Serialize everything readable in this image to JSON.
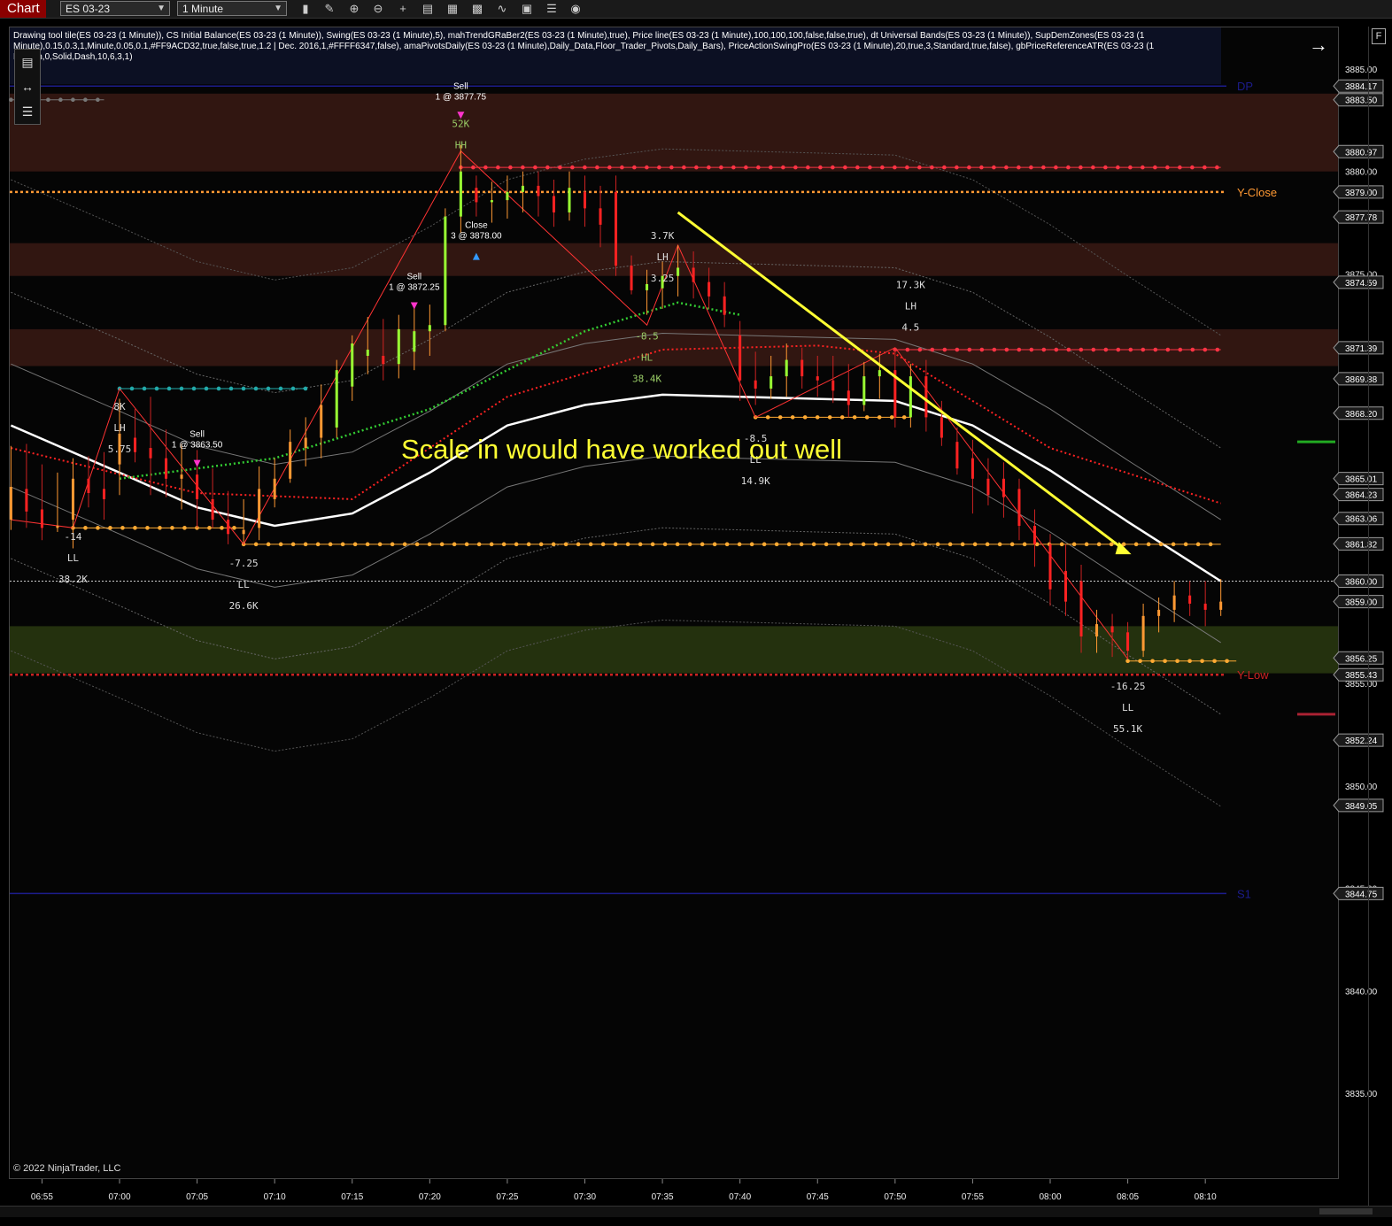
{
  "toolbar": {
    "tab_label": "Chart",
    "instrument": "ES 03-23",
    "interval": "1 Minute",
    "icons": [
      "bar-type-icon",
      "drawing-pencil-icon",
      "zoom-in-icon",
      "zoom-out-icon",
      "crosshair-icon",
      "properties-icon",
      "strategies-icon",
      "indicators-icon",
      "data-series-icon",
      "chart-trader-icon",
      "list-icon",
      "pin-icon"
    ]
  },
  "indicators_text": "Drawing tool tile(ES 03-23 (1 Minute)), CS Initial Balance(ES 03-23 (1 Minute)), Swing(ES 03-23 (1 Minute),5), mahTrendGRaBer2(ES 03-23 (1 Minute),true), Price line(ES 03-23 (1 Minute),100,100,100,false,false,true), dt Universal Bands(ES 03-23 (1 Minute)), SupDemZones(ES 03-23 (1 Minute),0.15,0.3,1,Minute,0.05,0.1,#FF9ACD32,true,false,true,1.2 | Dec. 2016,1,#FFFF6347,false), amaPivotsDaily(ES 03-23 (1 Minute),Daily_Data,Floor_Trader_Pivots,Daily_Bars), PriceActionSwingPro(ES 03-23 (1 Minute),20,true,3,Standard,true,false), gbPriceReferenceATR(ES 03-23 (1 Median,0,Solid,Dash,10,6,3,1)",
  "copyright": "© 2022 NinjaTrader, LLC",
  "annotation": "Scale in would have worked out well",
  "chart_data": {
    "type": "candlestick",
    "instrument": "ES 03-23",
    "interval": "1 Minute",
    "ylim": [
      3832.5,
      3887.5
    ],
    "x_ticks": [
      "06:55",
      "07:00",
      "07:05",
      "07:10",
      "07:15",
      "07:20",
      "07:25",
      "07:30",
      "07:35",
      "07:40",
      "07:45",
      "07:50",
      "07:55",
      "08:00",
      "08:05",
      "08:10"
    ],
    "y_ticks": [
      3885.0,
      3880.0,
      3875.0,
      3870.0,
      3865.0,
      3860.0,
      3855.0,
      3850.0,
      3845.0,
      3840.0,
      3835.0
    ],
    "price_labels": [
      {
        "value": 3884.17,
        "color": "#ffffff"
      },
      {
        "value": 3883.5,
        "color": "#ffffff"
      },
      {
        "value": 3880.97,
        "color": "#ffffff"
      },
      {
        "value": 3879.0,
        "color": "#ffffff"
      },
      {
        "value": 3877.78,
        "color": "#ffffff"
      },
      {
        "value": 3874.59,
        "color": "#ffffff"
      },
      {
        "value": 3871.39,
        "color": "#ffffff"
      },
      {
        "value": 3869.88,
        "color": "#ffffff"
      },
      {
        "value": 3868.2,
        "color": "#ffffff"
      },
      {
        "value": 3865.01,
        "color": "#ffffff"
      },
      {
        "value": 3864.23,
        "color": "#ffffff"
      },
      {
        "value": 3863.06,
        "color": "#ffffff"
      },
      {
        "value": 3861.82,
        "color": "#ffffff"
      },
      {
        "value": 3860.0,
        "color": "#ffffff"
      },
      {
        "value": 3859.0,
        "color": "#ffffff"
      },
      {
        "value": 3856.25,
        "color": "#ffffff"
      },
      {
        "value": 3855.43,
        "color": "#ffffff"
      },
      {
        "value": 3852.24,
        "color": "#ffffff"
      },
      {
        "value": 3849.05,
        "color": "#ffffff"
      },
      {
        "value": 3844.75,
        "color": "#ffffff"
      }
    ],
    "levels": [
      {
        "name": "DP",
        "value": 3884.17,
        "color": "#1c1c8c",
        "style": "solid"
      },
      {
        "name": "Y-Close",
        "value": 3879.0,
        "color": "#ff9933",
        "style": "dotted"
      },
      {
        "name": "Y-Low",
        "value": 3855.43,
        "color": "#cc2222",
        "style": "dotted"
      },
      {
        "name": "S1",
        "value": 3844.75,
        "color": "#1c1c8c",
        "style": "solid"
      }
    ],
    "zones": [
      {
        "from": 3880.0,
        "to": 3883.8,
        "color": "#3a1a14"
      },
      {
        "from": 3874.9,
        "to": 3876.5,
        "color": "#3a1a14"
      },
      {
        "from": 3870.5,
        "to": 3872.3,
        "color": "#3a1a14"
      },
      {
        "from": 3855.5,
        "to": 3857.8,
        "color": "#2a3a10"
      }
    ],
    "candles": [
      {
        "t": "06:53",
        "o": 3863.0,
        "h": 3866.6,
        "l": 3862.5,
        "c": 3864.6
      },
      {
        "t": "06:54",
        "o": 3864.5,
        "h": 3866.7,
        "l": 3862.6,
        "c": 3863.4
      },
      {
        "t": "06:55",
        "o": 3863.5,
        "h": 3865.7,
        "l": 3862.0,
        "c": 3862.6
      },
      {
        "t": "06:56",
        "o": 3862.6,
        "h": 3865.3,
        "l": 3862.4,
        "c": 3862.7
      },
      {
        "t": "06:57",
        "o": 3863.0,
        "h": 3866.0,
        "l": 3861.6,
        "c": 3865.0
      },
      {
        "t": "06:58",
        "o": 3865.0,
        "h": 3866.1,
        "l": 3863.6,
        "c": 3864.3
      },
      {
        "t": "06:59",
        "o": 3864.5,
        "h": 3866.3,
        "l": 3863.0,
        "c": 3864.0
      },
      {
        "t": "07:00",
        "o": 3865.7,
        "h": 3868.9,
        "l": 3864.2,
        "c": 3867.2
      },
      {
        "t": "07:01",
        "o": 3867.0,
        "h": 3868.4,
        "l": 3865.8,
        "c": 3866.3
      },
      {
        "t": "07:02",
        "o": 3866.5,
        "h": 3869.0,
        "l": 3864.2,
        "c": 3866.0
      },
      {
        "t": "07:03",
        "o": 3866.0,
        "h": 3867.4,
        "l": 3864.1,
        "c": 3865.0
      },
      {
        "t": "07:04",
        "o": 3865.0,
        "h": 3866.7,
        "l": 3863.5,
        "c": 3865.2
      },
      {
        "t": "07:05",
        "o": 3865.2,
        "h": 3866.4,
        "l": 3862.6,
        "c": 3864.0
      },
      {
        "t": "07:06",
        "o": 3864.0,
        "h": 3865.5,
        "l": 3862.6,
        "c": 3863.0
      },
      {
        "t": "07:07",
        "o": 3863.0,
        "h": 3864.4,
        "l": 3861.8,
        "c": 3862.3
      },
      {
        "t": "07:08",
        "o": 3862.3,
        "h": 3864.0,
        "l": 3861.9,
        "c": 3862.5
      },
      {
        "t": "07:09",
        "o": 3862.6,
        "h": 3865.6,
        "l": 3862.0,
        "c": 3864.5
      },
      {
        "t": "07:10",
        "o": 3864.0,
        "h": 3866.0,
        "l": 3863.6,
        "c": 3865.0
      },
      {
        "t": "07:11",
        "o": 3865.0,
        "h": 3867.4,
        "l": 3864.8,
        "c": 3866.8
      },
      {
        "t": "07:12",
        "o": 3866.5,
        "h": 3868.0,
        "l": 3865.6,
        "c": 3867.0
      },
      {
        "t": "07:13",
        "o": 3867.0,
        "h": 3869.6,
        "l": 3866.0,
        "c": 3868.6
      },
      {
        "t": "07:14",
        "o": 3867.5,
        "h": 3870.8,
        "l": 3867.0,
        "c": 3870.3
      },
      {
        "t": "07:15",
        "o": 3869.5,
        "h": 3872.0,
        "l": 3868.8,
        "c": 3871.6
      },
      {
        "t": "07:16",
        "o": 3871.0,
        "h": 3872.9,
        "l": 3870.1,
        "c": 3871.3
      },
      {
        "t": "07:17",
        "o": 3871.0,
        "h": 3872.8,
        "l": 3869.8,
        "c": 3870.6
      },
      {
        "t": "07:18",
        "o": 3870.6,
        "h": 3873.0,
        "l": 3869.9,
        "c": 3872.3
      },
      {
        "t": "07:19",
        "o": 3871.2,
        "h": 3873.4,
        "l": 3870.3,
        "c": 3872.2
      },
      {
        "t": "07:20",
        "o": 3872.2,
        "h": 3873.5,
        "l": 3871.0,
        "c": 3872.5
      },
      {
        "t": "07:21",
        "o": 3872.5,
        "h": 3878.2,
        "l": 3872.2,
        "c": 3877.8
      },
      {
        "t": "07:22",
        "o": 3877.8,
        "h": 3881.3,
        "l": 3877.0,
        "c": 3880.0
      },
      {
        "t": "07:23",
        "o": 3879.2,
        "h": 3879.8,
        "l": 3877.8,
        "c": 3878.5
      },
      {
        "t": "07:24",
        "o": 3878.5,
        "h": 3879.5,
        "l": 3877.5,
        "c": 3878.6
      },
      {
        "t": "07:25",
        "o": 3878.6,
        "h": 3879.8,
        "l": 3877.7,
        "c": 3879.0
      },
      {
        "t": "07:26",
        "o": 3879.0,
        "h": 3880.0,
        "l": 3878.0,
        "c": 3879.3
      },
      {
        "t": "07:27",
        "o": 3879.3,
        "h": 3880.0,
        "l": 3877.8,
        "c": 3878.8
      },
      {
        "t": "07:28",
        "o": 3878.8,
        "h": 3879.6,
        "l": 3877.3,
        "c": 3878.0
      },
      {
        "t": "07:29",
        "o": 3878.0,
        "h": 3880.0,
        "l": 3877.6,
        "c": 3879.2
      },
      {
        "t": "07:30",
        "o": 3879.0,
        "h": 3879.8,
        "l": 3877.3,
        "c": 3878.2
      },
      {
        "t": "07:31",
        "o": 3878.2,
        "h": 3879.3,
        "l": 3876.3,
        "c": 3877.4
      },
      {
        "t": "07:32",
        "o": 3879.0,
        "h": 3879.8,
        "l": 3874.9,
        "c": 3875.4
      },
      {
        "t": "07:33",
        "o": 3875.4,
        "h": 3875.9,
        "l": 3874.0,
        "c": 3874.2
      },
      {
        "t": "07:34",
        "o": 3874.2,
        "h": 3875.2,
        "l": 3873.0,
        "c": 3874.5
      },
      {
        "t": "07:35",
        "o": 3874.3,
        "h": 3875.6,
        "l": 3873.3,
        "c": 3874.9
      },
      {
        "t": "07:36",
        "o": 3874.9,
        "h": 3876.4,
        "l": 3873.9,
        "c": 3875.3
      },
      {
        "t": "07:37",
        "o": 3875.3,
        "h": 3876.1,
        "l": 3873.8,
        "c": 3874.6
      },
      {
        "t": "07:38",
        "o": 3874.6,
        "h": 3875.3,
        "l": 3873.3,
        "c": 3873.9
      },
      {
        "t": "07:39",
        "o": 3873.9,
        "h": 3874.6,
        "l": 3872.4,
        "c": 3873.0
      },
      {
        "t": "07:40",
        "o": 3872.0,
        "h": 3872.7,
        "l": 3868.8,
        "c": 3869.8
      },
      {
        "t": "07:41",
        "o": 3869.8,
        "h": 3871.2,
        "l": 3868.6,
        "c": 3869.4
      },
      {
        "t": "07:42",
        "o": 3869.4,
        "h": 3871.0,
        "l": 3868.9,
        "c": 3870.0
      },
      {
        "t": "07:43",
        "o": 3870.0,
        "h": 3871.6,
        "l": 3869.0,
        "c": 3870.8
      },
      {
        "t": "07:44",
        "o": 3870.8,
        "h": 3871.4,
        "l": 3869.4,
        "c": 3870.0
      },
      {
        "t": "07:45",
        "o": 3870.0,
        "h": 3871.0,
        "l": 3869.0,
        "c": 3869.8
      },
      {
        "t": "07:46",
        "o": 3869.8,
        "h": 3871.0,
        "l": 3868.7,
        "c": 3869.3
      },
      {
        "t": "07:47",
        "o": 3869.3,
        "h": 3870.6,
        "l": 3868.0,
        "c": 3868.6
      },
      {
        "t": "07:48",
        "o": 3868.6,
        "h": 3870.7,
        "l": 3868.3,
        "c": 3870.0
      },
      {
        "t": "07:49",
        "o": 3870.0,
        "h": 3871.1,
        "l": 3868.9,
        "c": 3870.3
      },
      {
        "t": "07:50",
        "o": 3870.3,
        "h": 3871.3,
        "l": 3867.5,
        "c": 3868.0
      },
      {
        "t": "07:51",
        "o": 3868.0,
        "h": 3870.6,
        "l": 3867.5,
        "c": 3870.0
      },
      {
        "t": "07:52",
        "o": 3870.0,
        "h": 3870.8,
        "l": 3867.3,
        "c": 3868.0
      },
      {
        "t": "07:53",
        "o": 3868.0,
        "h": 3868.8,
        "l": 3866.6,
        "c": 3867.0
      },
      {
        "t": "07:54",
        "o": 3866.8,
        "h": 3867.5,
        "l": 3865.2,
        "c": 3865.5
      },
      {
        "t": "07:55",
        "o": 3866.0,
        "h": 3866.9,
        "l": 3863.3,
        "c": 3865.0
      },
      {
        "t": "07:56",
        "o": 3865.0,
        "h": 3866.0,
        "l": 3863.7,
        "c": 3864.2
      },
      {
        "t": "07:57",
        "o": 3865.0,
        "h": 3865.8,
        "l": 3863.1,
        "c": 3864.1
      },
      {
        "t": "07:58",
        "o": 3864.5,
        "h": 3865.0,
        "l": 3862.0,
        "c": 3862.7
      },
      {
        "t": "07:59",
        "o": 3862.7,
        "h": 3863.5,
        "l": 3860.7,
        "c": 3861.8
      },
      {
        "t": "08:00",
        "o": 3861.8,
        "h": 3862.3,
        "l": 3858.8,
        "c": 3859.6
      },
      {
        "t": "08:01",
        "o": 3860.5,
        "h": 3861.8,
        "l": 3858.3,
        "c": 3859.0
      },
      {
        "t": "08:02",
        "o": 3860.0,
        "h": 3860.8,
        "l": 3856.5,
        "c": 3857.3
      },
      {
        "t": "08:03",
        "o": 3857.3,
        "h": 3858.6,
        "l": 3856.5,
        "c": 3857.9
      },
      {
        "t": "08:04",
        "o": 3857.8,
        "h": 3858.4,
        "l": 3856.3,
        "c": 3857.5
      },
      {
        "t": "08:05",
        "o": 3857.5,
        "h": 3858.0,
        "l": 3856.2,
        "c": 3856.6
      },
      {
        "t": "08:06",
        "o": 3856.6,
        "h": 3858.9,
        "l": 3856.3,
        "c": 3858.3
      },
      {
        "t": "08:07",
        "o": 3858.3,
        "h": 3859.2,
        "l": 3857.5,
        "c": 3858.6
      },
      {
        "t": "08:08",
        "o": 3858.6,
        "h": 3860.0,
        "l": 3858.0,
        "c": 3859.3
      },
      {
        "t": "08:09",
        "o": 3859.3,
        "h": 3860.0,
        "l": 3858.3,
        "c": 3858.9
      },
      {
        "t": "08:10",
        "o": 3858.9,
        "h": 3860.0,
        "l": 3857.8,
        "c": 3858.6
      },
      {
        "t": "08:11",
        "o": 3858.6,
        "h": 3860.1,
        "l": 3858.3,
        "c": 3859.0
      }
    ],
    "swing_labels": [
      {
        "t": "07:00",
        "y": 3866.8,
        "lines": [
          "8K",
          "LH",
          "5.75"
        ],
        "color": "#dddddd",
        "anchor": "above"
      },
      {
        "t": "06:57",
        "y": 3862.7,
        "lines": [
          "-14",
          "LL",
          "38.2K"
        ],
        "color": "#dddddd",
        "anchor": "below"
      },
      {
        "t": "07:08",
        "y": 3861.4,
        "lines": [
          "-7.25",
          "LL",
          "26.6K"
        ],
        "color": "#dddddd",
        "anchor": "below"
      },
      {
        "t": "07:22",
        "y": 3881.3,
        "lines": [
          "52K",
          "HH"
        ],
        "color": "#99cc66",
        "anchor": "above"
      },
      {
        "t": "07:35",
        "y": 3877.4,
        "lines": [
          "3.7K",
          "LH",
          "3.25"
        ],
        "color": "#dddddd",
        "anchor": "below"
      },
      {
        "t": "07:34",
        "y": 3872.5,
        "lines": [
          "-8.5",
          "HL",
          "38.4K"
        ],
        "color": "#99cc66",
        "anchor": "below"
      },
      {
        "t": "07:51",
        "y": 3875.0,
        "lines": [
          "17.3K",
          "LH",
          "4.5"
        ],
        "color": "#dddddd",
        "anchor": "below"
      },
      {
        "t": "07:41",
        "y": 3867.5,
        "lines": [
          "-8.5",
          "LL",
          "14.9K"
        ],
        "color": "#dddddd",
        "anchor": "below"
      },
      {
        "t": "08:05",
        "y": 3855.4,
        "lines": [
          "-16.25",
          "LL",
          "55.1K"
        ],
        "color": "#dddddd",
        "anchor": "below"
      }
    ],
    "trades": [
      {
        "t": "07:05",
        "y": 3866.0,
        "label": [
          "Sell",
          "1 @ 3863.50"
        ],
        "direction": "sell",
        "color": "#ff33cc"
      },
      {
        "t": "07:19",
        "y": 3873.7,
        "label": [
          "Sell",
          "1 @ 3872.25"
        ],
        "direction": "sell",
        "color": "#ff33cc"
      },
      {
        "t": "07:22",
        "y": 3883.0,
        "label": [
          "Sell",
          "1 @ 3877.75"
        ],
        "direction": "sell",
        "color": "#ff33cc"
      },
      {
        "t": "07:23",
        "y": 3876.2,
        "label": [
          "Close",
          "3 @ 3878.00"
        ],
        "direction": "buy",
        "color": "#3399ff"
      }
    ]
  }
}
